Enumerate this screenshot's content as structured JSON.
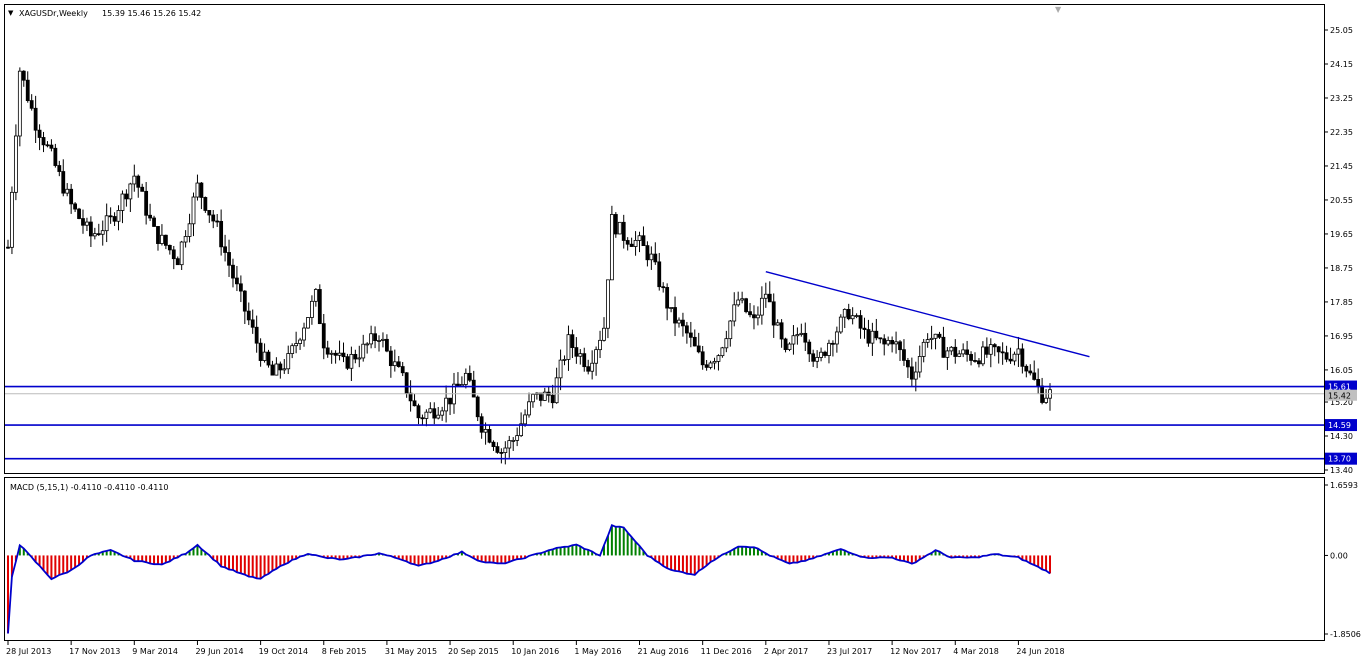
{
  "header": {
    "symbol_label": "XAGUSDr,Weekly",
    "ohlc_label": "15.39 15.46 15.26 15.42"
  },
  "indicator": {
    "label": "MACD (5,15,1) -0.4110 -0.4110 -0.4110"
  },
  "price_axis": {
    "ticks": [
      "25.05",
      "24.15",
      "23.25",
      "22.35",
      "21.45",
      "20.55",
      "19.65",
      "18.75",
      "17.85",
      "16.95",
      "16.05",
      "15.20",
      "14.30",
      "13.40"
    ]
  },
  "macd_axis": {
    "ticks": [
      "1.6593",
      "0.00",
      "-1.8506"
    ]
  },
  "time_axis": {
    "labels": [
      "28 Jul 2013",
      "17 Nov 2013",
      "9 Mar 2014",
      "29 Jun 2014",
      "19 Oct 2014",
      "8 Feb 2015",
      "31 May 2015",
      "20 Sep 2015",
      "10 Jan 2016",
      "1 May 2016",
      "21 Aug 2016",
      "11 Dec 2016",
      "2 Apr 2017",
      "23 Jul 2017",
      "12 Nov 2017",
      "4 Mar 2018",
      "24 Jun 2018"
    ]
  },
  "levels": [
    {
      "label": "15.61",
      "value": 15.61
    },
    {
      "label": "14.59",
      "value": 14.59
    },
    {
      "label": "13.70",
      "value": 13.7
    }
  ],
  "current_price": {
    "label": "15.42",
    "value": 15.42
  },
  "colors": {
    "level_line": "#0000cc",
    "trend_line": "#0000cc",
    "candle": "#000000",
    "hist_up": "#008000",
    "hist_down": "#e00000",
    "signal_line": "#0000cc"
  },
  "chart_data": {
    "type": "candlestick",
    "symbol": "XAGUSDr",
    "timeframe": "Weekly",
    "price_range": [
      13.4,
      25.05
    ],
    "macd_range": [
      -1.8506,
      1.6593
    ],
    "price_keypoints": [
      [
        "2013-07-28",
        19.3
      ],
      [
        "2013-08-18",
        24.0
      ],
      [
        "2013-09-15",
        22.6
      ],
      [
        "2013-10-13",
        21.7
      ],
      [
        "2013-11-17",
        20.4
      ],
      [
        "2013-12-22",
        19.6
      ],
      [
        "2014-01-26",
        20.0
      ],
      [
        "2014-03-09",
        21.2
      ],
      [
        "2014-04-13",
        19.7
      ],
      [
        "2014-05-25",
        19.0
      ],
      [
        "2014-06-29",
        20.9
      ],
      [
        "2014-08-03",
        19.8
      ],
      [
        "2014-09-07",
        18.2
      ],
      [
        "2014-10-19",
        16.5
      ],
      [
        "2014-11-09",
        15.9
      ],
      [
        "2014-12-07",
        16.3
      ],
      [
        "2015-01-25",
        18.0
      ],
      [
        "2015-02-08",
        16.8
      ],
      [
        "2015-03-15",
        16.2
      ],
      [
        "2015-04-19",
        16.6
      ],
      [
        "2015-05-17",
        17.0
      ],
      [
        "2015-05-31",
        16.5
      ],
      [
        "2015-06-28",
        15.8
      ],
      [
        "2015-07-26",
        14.8
      ],
      [
        "2015-08-23",
        15.0
      ],
      [
        "2015-09-20",
        15.3
      ],
      [
        "2015-10-18",
        15.9
      ],
      [
        "2015-11-15",
        14.6
      ],
      [
        "2015-12-20",
        13.9
      ],
      [
        "2016-01-10",
        14.2
      ],
      [
        "2016-02-14",
        15.3
      ],
      [
        "2016-03-20",
        15.4
      ],
      [
        "2016-04-17",
        16.8
      ],
      [
        "2016-05-22",
        16.2
      ],
      [
        "2016-06-19",
        17.2
      ],
      [
        "2016-07-03",
        20.0
      ],
      [
        "2016-07-24",
        19.6
      ],
      [
        "2016-08-21",
        19.4
      ],
      [
        "2016-09-11",
        19.0
      ],
      [
        "2016-10-16",
        17.5
      ],
      [
        "2016-11-13",
        17.0
      ],
      [
        "2016-12-11",
        16.2
      ],
      [
        "2017-01-08",
        16.5
      ],
      [
        "2017-02-12",
        17.9
      ],
      [
        "2017-03-12",
        17.3
      ],
      [
        "2017-04-02",
        18.1
      ],
      [
        "2017-05-07",
        16.4
      ],
      [
        "2017-06-04",
        17.2
      ],
      [
        "2017-07-02",
        16.2
      ],
      [
        "2017-07-23",
        16.8
      ],
      [
        "2017-08-27",
        17.6
      ],
      [
        "2017-09-24",
        17.0
      ],
      [
        "2017-10-29",
        16.7
      ],
      [
        "2017-11-12",
        16.9
      ],
      [
        "2017-12-17",
        15.9
      ],
      [
        "2018-01-14",
        17.0
      ],
      [
        "2018-02-11",
        16.6
      ],
      [
        "2018-03-04",
        16.5
      ],
      [
        "2018-04-08",
        16.4
      ],
      [
        "2018-05-06",
        16.5
      ],
      [
        "2018-06-03",
        16.4
      ],
      [
        "2018-06-24",
        16.6
      ],
      [
        "2018-07-15",
        15.9
      ],
      [
        "2018-08-05",
        15.4
      ],
      [
        "2018-08-19",
        15.42
      ]
    ],
    "macd_keypoints": [
      [
        "2013-07-28",
        -1.85
      ],
      [
        "2013-08-04",
        -0.5
      ],
      [
        "2013-08-18",
        0.25
      ],
      [
        "2013-09-08",
        -0.05
      ],
      [
        "2013-10-13",
        -0.55
      ],
      [
        "2013-11-17",
        -0.35
      ],
      [
        "2013-12-22",
        0.0
      ],
      [
        "2014-01-26",
        0.12
      ],
      [
        "2014-03-09",
        -0.12
      ],
      [
        "2014-04-27",
        -0.22
      ],
      [
        "2014-06-08",
        0.05
      ],
      [
        "2014-06-29",
        0.25
      ],
      [
        "2014-08-10",
        -0.25
      ],
      [
        "2014-09-28",
        -0.5
      ],
      [
        "2014-10-19",
        -0.55
      ],
      [
        "2014-11-30",
        -0.2
      ],
      [
        "2015-01-11",
        0.05
      ],
      [
        "2015-02-08",
        -0.05
      ],
      [
        "2015-03-15",
        -0.1
      ],
      [
        "2015-05-17",
        0.05
      ],
      [
        "2015-06-28",
        -0.1
      ],
      [
        "2015-07-26",
        -0.25
      ],
      [
        "2015-08-23",
        -0.15
      ],
      [
        "2015-10-11",
        0.08
      ],
      [
        "2015-11-15",
        -0.15
      ],
      [
        "2015-12-20",
        -0.2
      ],
      [
        "2016-01-24",
        -0.08
      ],
      [
        "2016-03-20",
        0.15
      ],
      [
        "2016-05-01",
        0.25
      ],
      [
        "2016-06-12",
        0.0
      ],
      [
        "2016-07-03",
        0.7
      ],
      [
        "2016-07-24",
        0.65
      ],
      [
        "2016-09-04",
        0.0
      ],
      [
        "2016-10-16",
        -0.35
      ],
      [
        "2016-11-27",
        -0.45
      ],
      [
        "2016-12-25",
        -0.15
      ],
      [
        "2017-02-12",
        0.22
      ],
      [
        "2017-03-12",
        0.2
      ],
      [
        "2017-04-09",
        0.0
      ],
      [
        "2017-05-14",
        -0.2
      ],
      [
        "2017-06-18",
        -0.1
      ],
      [
        "2017-08-13",
        0.15
      ],
      [
        "2017-09-24",
        -0.05
      ],
      [
        "2017-11-12",
        -0.05
      ],
      [
        "2017-12-17",
        -0.2
      ],
      [
        "2018-01-28",
        0.12
      ],
      [
        "2018-02-25",
        -0.05
      ],
      [
        "2018-04-08",
        -0.05
      ],
      [
        "2018-05-13",
        0.03
      ],
      [
        "2018-06-24",
        -0.05
      ],
      [
        "2018-08-19",
        -0.41
      ]
    ],
    "trendline": [
      [
        "2017-04-02",
        18.65
      ],
      [
        "2018-10-28",
        16.4
      ]
    ],
    "horizontal_levels": [
      15.61,
      14.59,
      13.7
    ]
  }
}
